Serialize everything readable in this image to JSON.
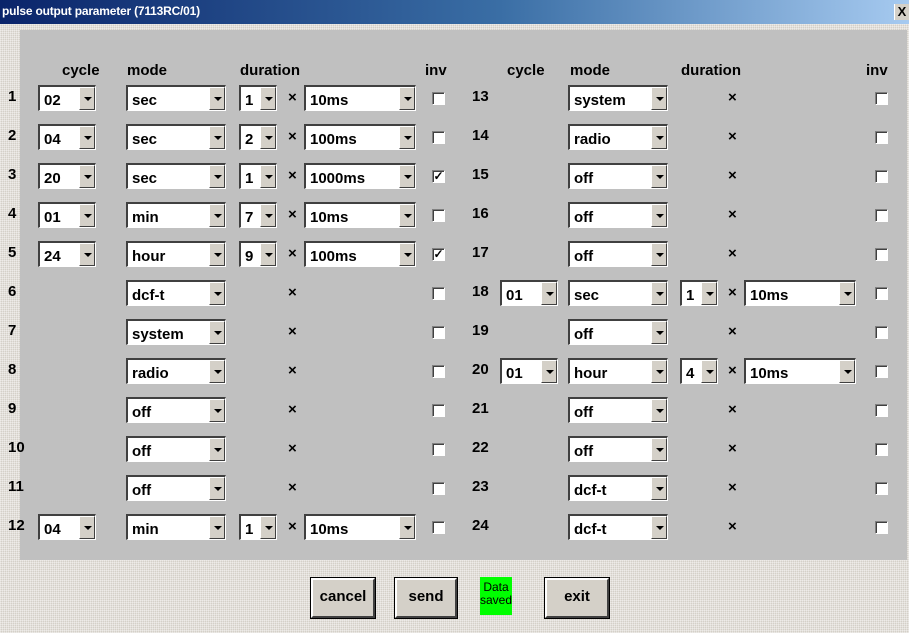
{
  "title": "pulse output parameter (7113RC/01)",
  "close": "X",
  "headers": {
    "cycle": "cycle",
    "mode": "mode",
    "duration": "duration",
    "inv": "inv"
  },
  "cross": "×",
  "check_mark": "✓",
  "rows": [
    {
      "n": "1",
      "cycle": "02",
      "mode": "sec",
      "mult": "1",
      "unit": "10ms",
      "inv": false
    },
    {
      "n": "2",
      "cycle": "04",
      "mode": "sec",
      "mult": "2",
      "unit": "100ms",
      "inv": false
    },
    {
      "n": "3",
      "cycle": "20",
      "mode": "sec",
      "mult": "1",
      "unit": "1000ms",
      "inv": true
    },
    {
      "n": "4",
      "cycle": "01",
      "mode": "min",
      "mult": "7",
      "unit": "10ms",
      "inv": false
    },
    {
      "n": "5",
      "cycle": "24",
      "mode": "hour",
      "mult": "9",
      "unit": "100ms",
      "inv": true
    },
    {
      "n": "6",
      "cycle": "",
      "mode": "dcf-t",
      "mult": "",
      "unit": "",
      "inv": false
    },
    {
      "n": "7",
      "cycle": "",
      "mode": "system",
      "mult": "",
      "unit": "",
      "inv": false
    },
    {
      "n": "8",
      "cycle": "",
      "mode": "radio",
      "mult": "",
      "unit": "",
      "inv": false
    },
    {
      "n": "9",
      "cycle": "",
      "mode": "off",
      "mult": "",
      "unit": "",
      "inv": false
    },
    {
      "n": "10",
      "cycle": "",
      "mode": "off",
      "mult": "",
      "unit": "",
      "inv": false
    },
    {
      "n": "11",
      "cycle": "",
      "mode": "off",
      "mult": "",
      "unit": "",
      "inv": false
    },
    {
      "n": "12",
      "cycle": "04",
      "mode": "min",
      "mult": "1",
      "unit": "10ms",
      "inv": false
    },
    {
      "n": "13",
      "cycle": "",
      "mode": "system",
      "mult": "",
      "unit": "",
      "inv": false
    },
    {
      "n": "14",
      "cycle": "",
      "mode": "radio",
      "mult": "",
      "unit": "",
      "inv": false
    },
    {
      "n": "15",
      "cycle": "",
      "mode": "off",
      "mult": "",
      "unit": "",
      "inv": false
    },
    {
      "n": "16",
      "cycle": "",
      "mode": "off",
      "mult": "",
      "unit": "",
      "inv": false
    },
    {
      "n": "17",
      "cycle": "",
      "mode": "off",
      "mult": "",
      "unit": "",
      "inv": false
    },
    {
      "n": "18",
      "cycle": "01",
      "mode": "sec",
      "mult": "1",
      "unit": "10ms",
      "inv": false
    },
    {
      "n": "19",
      "cycle": "",
      "mode": "off",
      "mult": "",
      "unit": "",
      "inv": false
    },
    {
      "n": "20",
      "cycle": "01",
      "mode": "hour",
      "mult": "4",
      "unit": "10ms",
      "inv": false
    },
    {
      "n": "21",
      "cycle": "",
      "mode": "off",
      "mult": "",
      "unit": "",
      "inv": false
    },
    {
      "n": "22",
      "cycle": "",
      "mode": "off",
      "mult": "",
      "unit": "",
      "inv": false
    },
    {
      "n": "23",
      "cycle": "",
      "mode": "dcf-t",
      "mult": "",
      "unit": "",
      "inv": false
    },
    {
      "n": "24",
      "cycle": "",
      "mode": "dcf-t",
      "mult": "",
      "unit": "",
      "inv": false
    }
  ],
  "buttons": {
    "cancel": "cancel",
    "send": "send",
    "exit": "exit"
  },
  "status": {
    "line1": "Data",
    "line2": "saved",
    "color": "#00ff00"
  }
}
